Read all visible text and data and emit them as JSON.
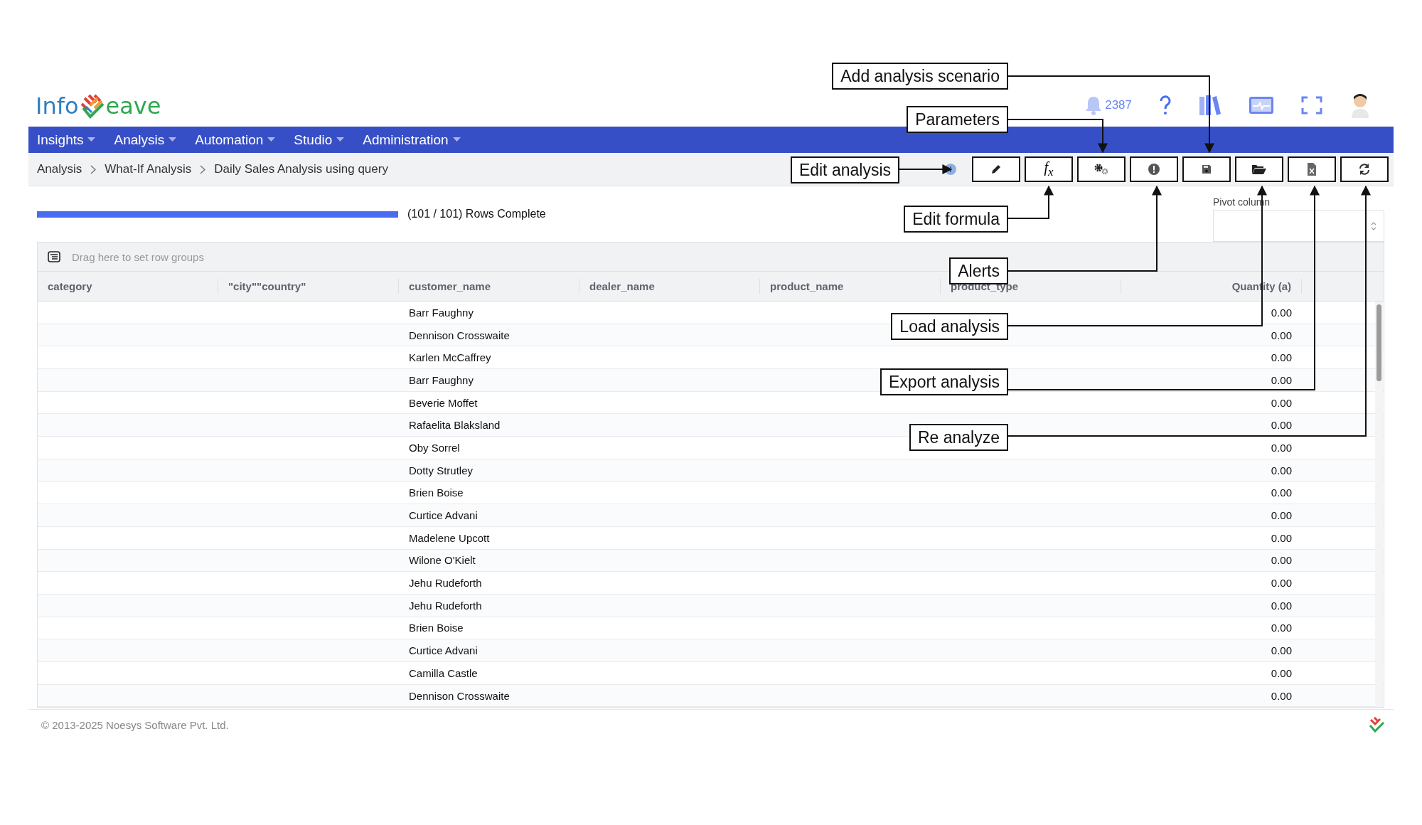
{
  "logo": {
    "left": "Info",
    "right": "eave"
  },
  "header": {
    "notifications": "2387"
  },
  "nav": [
    {
      "label": "Insights"
    },
    {
      "label": "Analysis"
    },
    {
      "label": "Automation"
    },
    {
      "label": "Studio"
    },
    {
      "label": "Administration"
    }
  ],
  "breadcrumb": [
    "Analysis",
    "What-If Analysis",
    "Daily Sales Analysis using query"
  ],
  "toolbar": [
    {
      "kind": "edit"
    },
    {
      "kind": "formula",
      "label": "f$_{x}$"
    },
    {
      "kind": "parameters"
    },
    {
      "kind": "alerts"
    },
    {
      "kind": "save"
    },
    {
      "kind": "load"
    },
    {
      "kind": "export"
    },
    {
      "kind": "refresh"
    }
  ],
  "progress": {
    "level": 1,
    "text": "(101 / 101) Rows Complete"
  },
  "pivot": {
    "label": "Pivot column"
  },
  "grid": {
    "group_panel": "Drag here to set row groups",
    "columns": [
      "category",
      "\"city\"\"country\"",
      "customer_name",
      "dealer_name",
      "product_name",
      "product_type",
      "Quantity (a)"
    ],
    "rows": [
      {
        "customer_name": "Barr Faughny",
        "quantity": "0.00"
      },
      {
        "customer_name": "Dennison Crosswaite",
        "quantity": "0.00"
      },
      {
        "customer_name": "Karlen McCaffrey",
        "quantity": "0.00"
      },
      {
        "customer_name": "Barr Faughny",
        "quantity": "0.00"
      },
      {
        "customer_name": "Beverie Moffet",
        "quantity": "0.00"
      },
      {
        "customer_name": "Rafaelita Blaksland",
        "quantity": "0.00"
      },
      {
        "customer_name": "Oby Sorrel",
        "quantity": "0.00"
      },
      {
        "customer_name": "Dotty Strutley",
        "quantity": "0.00"
      },
      {
        "customer_name": "Brien Boise",
        "quantity": "0.00"
      },
      {
        "customer_name": "Curtice Advani",
        "quantity": "0.00"
      },
      {
        "customer_name": "Madelene Upcott",
        "quantity": "0.00"
      },
      {
        "customer_name": "Wilone O'Kielt",
        "quantity": "0.00"
      },
      {
        "customer_name": "Jehu Rudeforth",
        "quantity": "0.00"
      },
      {
        "customer_name": "Jehu Rudeforth",
        "quantity": "0.00"
      },
      {
        "customer_name": "Brien Boise",
        "quantity": "0.00"
      },
      {
        "customer_name": "Curtice Advani",
        "quantity": "0.00"
      },
      {
        "customer_name": "Camilla Castle",
        "quantity": "0.00"
      },
      {
        "customer_name": "Dennison Crosswaite",
        "quantity": "0.00"
      }
    ]
  },
  "footer": "© 2013-2025 Noesys Software Pvt. Ltd.",
  "callouts": [
    {
      "label": "Add analysis scenario"
    },
    {
      "label": "Parameters"
    },
    {
      "label": "Edit analysis"
    },
    {
      "label": "Edit formula"
    },
    {
      "label": "Alerts"
    },
    {
      "label": "Load analysis"
    },
    {
      "label": "Export analysis"
    },
    {
      "label": "Re analyze"
    }
  ]
}
